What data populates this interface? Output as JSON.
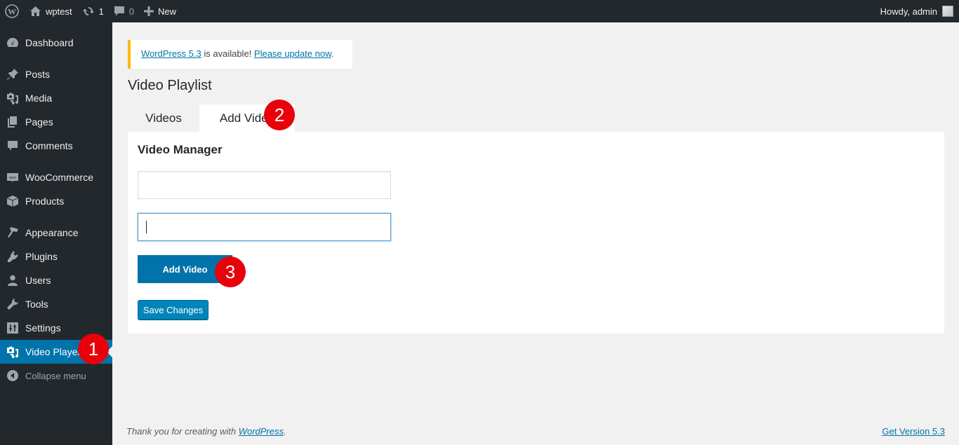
{
  "adminbar": {
    "site_name": "wptest",
    "updates_count": "1",
    "comments_count": "0",
    "new_label": "New",
    "greeting": "Howdy, admin"
  },
  "sidebar": {
    "items": [
      {
        "label": "Dashboard",
        "icon": "dashboard-icon"
      },
      {
        "label": "Posts",
        "icon": "pin-icon"
      },
      {
        "label": "Media",
        "icon": "media-icon"
      },
      {
        "label": "Pages",
        "icon": "pages-icon"
      },
      {
        "label": "Comments",
        "icon": "comment-icon"
      },
      {
        "label": "WooCommerce",
        "icon": "woocommerce-icon"
      },
      {
        "label": "Products",
        "icon": "box-icon"
      },
      {
        "label": "Appearance",
        "icon": "brush-icon"
      },
      {
        "label": "Plugins",
        "icon": "plug-icon"
      },
      {
        "label": "Users",
        "icon": "user-icon"
      },
      {
        "label": "Tools",
        "icon": "wrench-icon"
      },
      {
        "label": "Settings",
        "icon": "sliders-icon"
      },
      {
        "label": "Video Player",
        "icon": "media-icon",
        "active": true
      },
      {
        "label": "Collapse menu",
        "icon": "collapse-icon"
      }
    ]
  },
  "notice": {
    "link1": "WordPress 5.3",
    "middle": " is available! ",
    "link2": "Please update now",
    "end": "."
  },
  "page": {
    "title": "Video Playlist",
    "tabs": [
      {
        "label": "Videos",
        "active": false
      },
      {
        "label": "Add Video",
        "active": true
      }
    ],
    "panel_title": "Video Manager",
    "field1_value": "",
    "field2_value": "",
    "add_video_label": "Add Video",
    "save_label": "Save Changes"
  },
  "annotations": [
    "1",
    "2",
    "3"
  ],
  "footer": {
    "left_text": "Thank you for creating with ",
    "left_link": "WordPress",
    "left_end": ".",
    "right_link": "Get Version 5.3"
  },
  "colors": {
    "accent": "#0073aa",
    "adminbar_bg": "#23282d",
    "notice_border": "#ffb900",
    "badge": "#e8000a"
  }
}
